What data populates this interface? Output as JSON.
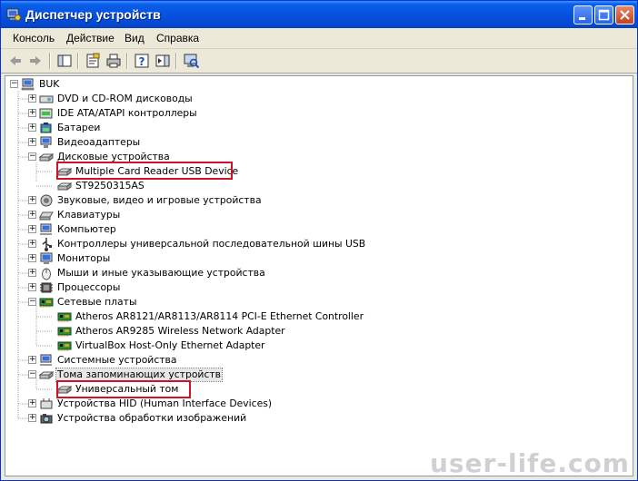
{
  "window": {
    "title": "Диспетчер устройств"
  },
  "menu": [
    "Консоль",
    "Действие",
    "Вид",
    "Справка"
  ],
  "tree": {
    "root": "BUK",
    "items": [
      {
        "label": "DVD и CD-ROM дисководы",
        "icon": "dvd-drive-icon"
      },
      {
        "label": "IDE ATA/ATAPI контроллеры",
        "icon": "ide-controller-icon"
      },
      {
        "label": "Батареи",
        "icon": "battery-icon"
      },
      {
        "label": "Видеоадаптеры",
        "icon": "display-adapter-icon"
      },
      {
        "label": "Дисковые устройства",
        "icon": "disk-drive-icon"
      },
      {
        "label": "Multiple Card  Reader USB Device",
        "icon": "disk-drive-icon"
      },
      {
        "label": "ST9250315AS",
        "icon": "disk-drive-icon"
      },
      {
        "label": "Звуковые, видео и игровые устройства",
        "icon": "speaker-icon"
      },
      {
        "label": "Клавиатуры",
        "icon": "keyboard-icon"
      },
      {
        "label": "Компьютер",
        "icon": "computer-icon"
      },
      {
        "label": "Контроллеры универсальной последовательной шины USB",
        "icon": "usb-icon"
      },
      {
        "label": "Мониторы",
        "icon": "monitor-icon"
      },
      {
        "label": "Мыши и иные указывающие устройства",
        "icon": "mouse-icon"
      },
      {
        "label": "Процессоры",
        "icon": "processor-icon"
      },
      {
        "label": "Сетевые платы",
        "icon": "network-card-icon"
      },
      {
        "label": "Atheros AR8121/AR8113/AR8114 PCI-E Ethernet Controller",
        "icon": "network-card-icon"
      },
      {
        "label": "Atheros AR9285 Wireless Network Adapter",
        "icon": "network-card-icon"
      },
      {
        "label": "VirtualBox Host-Only Ethernet Adapter",
        "icon": "network-card-icon"
      },
      {
        "label": "Системные устройства",
        "icon": "system-device-icon"
      },
      {
        "label": "Тома запоминающих устройств",
        "icon": "storage-volume-icon"
      },
      {
        "label": "Универсальный том",
        "icon": "storage-volume-icon"
      },
      {
        "label": "Устройства HID (Human Interface Devices)",
        "icon": "hid-icon"
      },
      {
        "label": "Устройства обработки изображений",
        "icon": "imaging-device-icon"
      }
    ]
  },
  "watermark": "user-life.com",
  "colors": {
    "titlebar": "#0553e0",
    "highlight_border": "#d0112b",
    "window_bg": "#ece9d8"
  }
}
